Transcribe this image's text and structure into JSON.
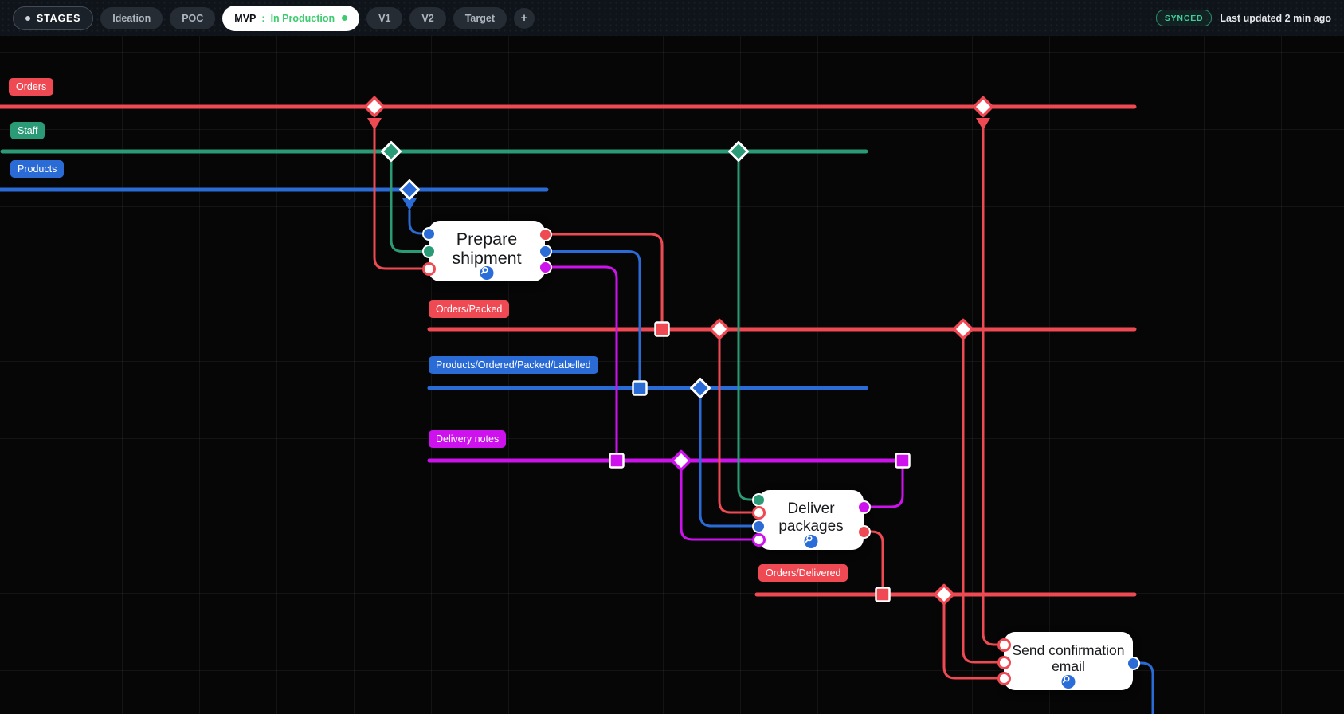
{
  "topbar": {
    "menu_label": "STAGES",
    "tabs": [
      {
        "label": "Ideation"
      },
      {
        "label": "POC"
      },
      {
        "label": "MVP",
        "separator": ":",
        "status": "In Production",
        "active": true
      },
      {
        "label": "V1"
      },
      {
        "label": "V2"
      },
      {
        "label": "Target"
      }
    ],
    "add_button": "+",
    "sync_status": "SYNCED",
    "last_updated": "Last updated 2 min ago"
  },
  "canvas": {
    "lanes": [
      {
        "label": "Orders",
        "color": "#ef4a53"
      },
      {
        "label": "Staff",
        "color": "#2b9b77"
      },
      {
        "label": "Products",
        "color": "#2a6bd6"
      },
      {
        "label": "Orders/Packed",
        "color": "#ef4a53"
      },
      {
        "label": "Products/Ordered/Packed/Labelled",
        "color": "#2a6bd6"
      },
      {
        "label": "Delivery notes",
        "color": "#ce12ed"
      },
      {
        "label": "Orders/Delivered",
        "color": "#ef4a53"
      }
    ],
    "nodes": [
      {
        "label": "Prepare shipment",
        "badge_icon": "magnifier"
      },
      {
        "label": "Deliver packages",
        "badge_icon": "magnifier"
      },
      {
        "label": "Send confirmation email",
        "badge_icon": "magnifier"
      }
    ]
  },
  "colors": {
    "red": "#ef4a53",
    "teal": "#2b9b77",
    "blue": "#2a6bd6",
    "magenta": "#ce12ed",
    "green": "#3dcb6f",
    "synced": "#3fcf9a",
    "badge": "#2a6cd8"
  }
}
